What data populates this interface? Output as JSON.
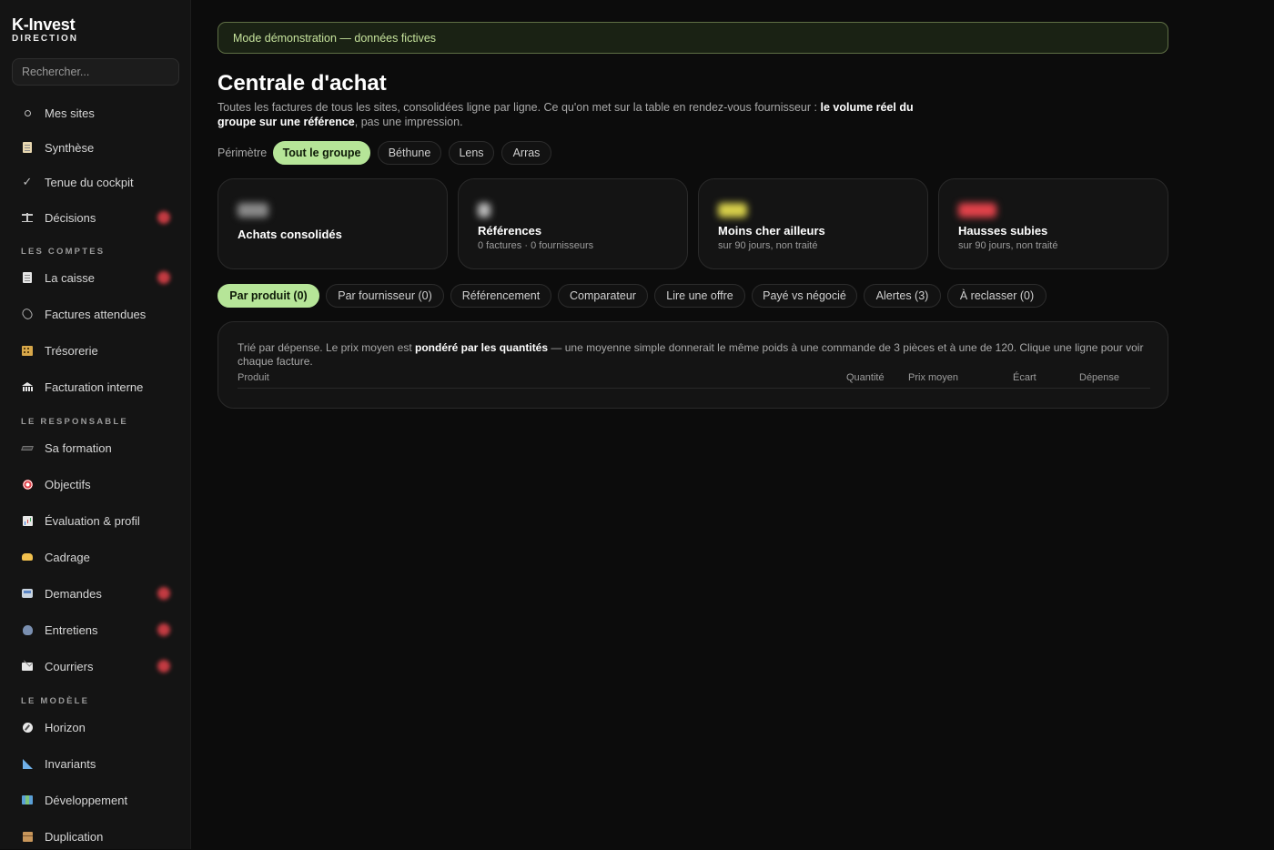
{
  "brand": {
    "name": "K-Invest",
    "subtitle": "DIRECTION"
  },
  "search": {
    "placeholder": "Rechercher..."
  },
  "sidebar": {
    "items": [
      {
        "label": "Mes sites",
        "icon": "circle-icon"
      },
      {
        "label": "Synthèse",
        "icon": "clipboard-icon"
      },
      {
        "label": "Tenue du cockpit",
        "icon": "check-icon"
      },
      {
        "label": "Décisions",
        "icon": "scale-icon",
        "badge": true
      },
      {
        "label": "La caisse",
        "icon": "receipt-icon",
        "badge": true
      },
      {
        "label": "Factures attendues",
        "icon": "paperclip-icon"
      },
      {
        "label": "Trésorerie",
        "icon": "building-icon"
      },
      {
        "label": "Facturation interne",
        "icon": "bank-icon"
      },
      {
        "label": "Sa formation",
        "icon": "graduation-cap-icon"
      },
      {
        "label": "Objectifs",
        "icon": "target-icon"
      },
      {
        "label": "Évaluation & profil",
        "icon": "bar-chart-icon"
      },
      {
        "label": "Cadrage",
        "icon": "handshake-icon"
      },
      {
        "label": "Demandes",
        "icon": "inbox-tray-icon",
        "badge": true
      },
      {
        "label": "Entretiens",
        "icon": "speaking-head-icon",
        "badge": true
      },
      {
        "label": "Courriers",
        "icon": "envelope-icon",
        "badge": true
      },
      {
        "label": "Horizon",
        "icon": "compass-icon"
      },
      {
        "label": "Invariants",
        "icon": "ruler-icon"
      },
      {
        "label": "Développement",
        "icon": "map-icon"
      },
      {
        "label": "Duplication",
        "icon": "package-icon"
      }
    ],
    "sections": [
      "LES COMPTES",
      "LE RESPONSABLE",
      "LE MODÈLE"
    ]
  },
  "banner": {
    "text": "Mode démonstration — données fictives"
  },
  "page": {
    "title": "Centrale d'achat",
    "desc_pre": "Toutes les factures de tous les sites, consolidées ligne par ligne. Ce qu'on met sur la table en rendez-vous fournisseur : ",
    "desc_bold": "le volume réel du groupe sur une référence",
    "desc_post": ", pas une impression."
  },
  "perimetre": {
    "label": "Périmètre",
    "options": [
      "Tout le groupe",
      "Béthune",
      "Lens",
      "Arras"
    ],
    "selected": "Tout le groupe"
  },
  "kpis": [
    {
      "label": "Achats consolidés",
      "sub": "",
      "color": "#8a8a8a"
    },
    {
      "label": "Références",
      "sub": "0 factures · 0 fournisseurs",
      "color": "#bdbdbd"
    },
    {
      "label": "Moins cher ailleurs",
      "sub": "sur 90 jours, non traité",
      "color": "#d8d04a"
    },
    {
      "label": "Hausses subies",
      "sub": "sur 90 jours, non traité",
      "color": "#e2424a"
    }
  ],
  "tabs": {
    "items": [
      "Par produit (0)",
      "Par fournisseur (0)",
      "Référencement",
      "Comparateur",
      "Lire une offre",
      "Payé vs négocié",
      "Alertes (3)",
      "À reclasser (0)"
    ],
    "selected": "Par produit (0)"
  },
  "table": {
    "note_pre": "Trié par dépense. Le prix moyen est ",
    "note_bold": "pondéré par les quantités",
    "note_post": " — une moyenne simple donnerait le même poids à une commande de 3 pièces et à une de 120. Clique une ligne pour voir chaque facture.",
    "columns": [
      "Produit",
      "Quantité",
      "Prix moyen",
      "Écart",
      "Dépense"
    ],
    "rows": []
  },
  "colors": {
    "accent": "#b6e598",
    "badge": "#e2424a",
    "banner_bg": "#1a2214",
    "banner_text": "#c6e39c"
  }
}
